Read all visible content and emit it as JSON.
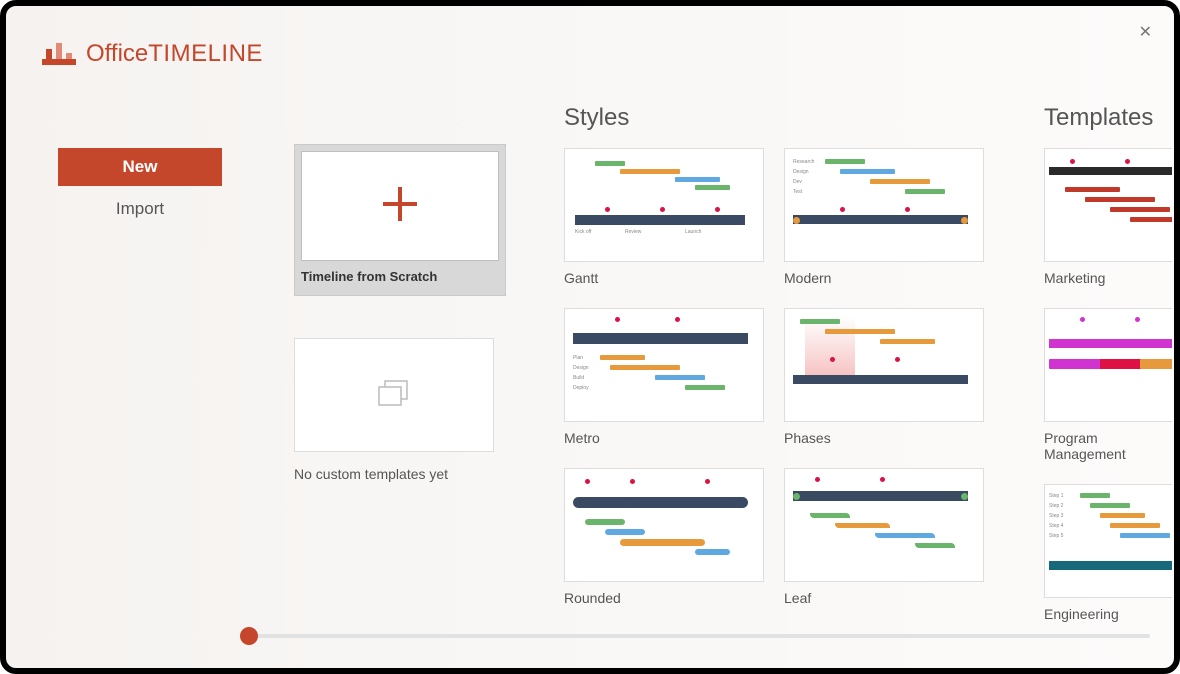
{
  "brand": {
    "name_light": "Office",
    "name_bold": "TIMELINE"
  },
  "close_glyph": "✕",
  "nav": {
    "new": "New",
    "import": "Import"
  },
  "scratch": {
    "label": "Timeline from Scratch"
  },
  "custom": {
    "caption": "No custom templates yet"
  },
  "sections": {
    "styles": "Styles",
    "templates": "Templates"
  },
  "styles": {
    "gantt": "Gantt",
    "modern": "Modern",
    "metro": "Metro",
    "phases": "Phases",
    "rounded": "Rounded",
    "leaf": "Leaf"
  },
  "templates": {
    "marketing": "Marketing",
    "program": "Program Management",
    "engineering": "Engineering"
  },
  "colors": {
    "accent": "#c4472b"
  }
}
